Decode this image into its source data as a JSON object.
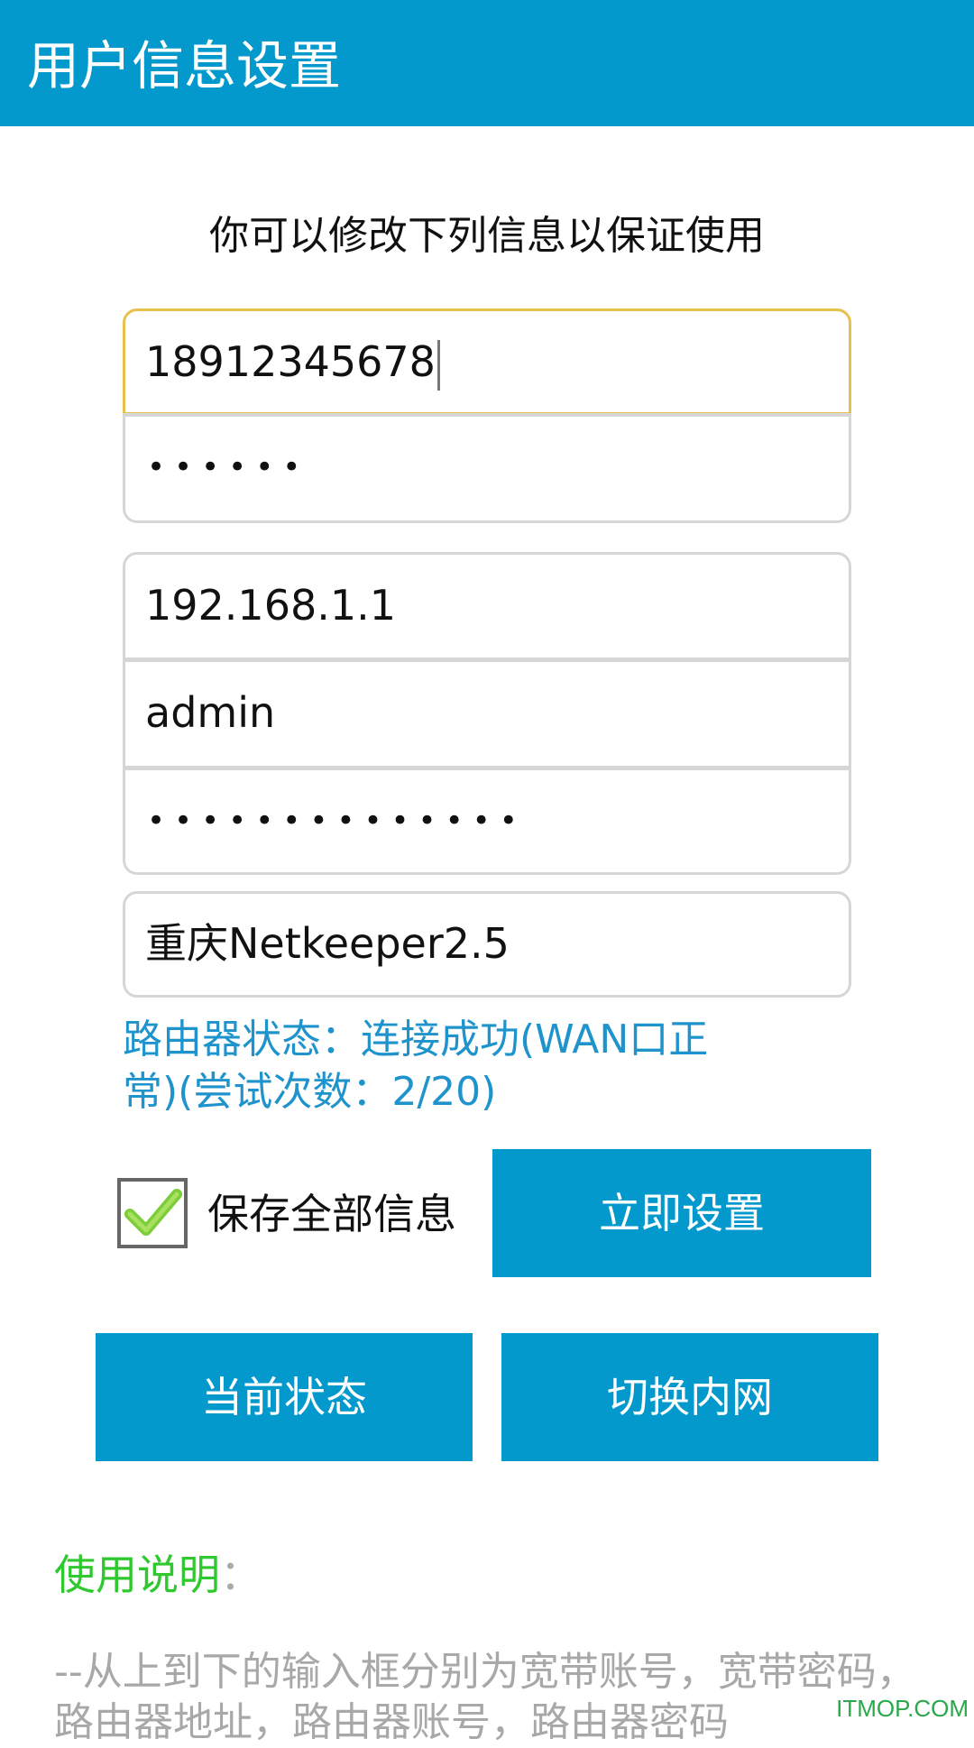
{
  "title_bar": {
    "title": "用户信息设置"
  },
  "subtitle": "你可以修改下列信息以保证使用",
  "fields": {
    "broadband_account": "18912345678",
    "broadband_password_masked": "••••••",
    "router_address": "192.168.1.1",
    "router_account": "admin",
    "router_password_masked": "••••••••••••••",
    "dial_mode": "重庆Netkeeper2.5"
  },
  "router_status": {
    "line1": "路由器状态：连接成功(WAN口正",
    "line2": "常)(尝试次数：2/20)"
  },
  "save_all": {
    "label": "保存全部信息",
    "checked": true
  },
  "buttons": {
    "apply_now": "立即设置",
    "current_status": "当前状态",
    "switch_intranet": "切换内网"
  },
  "help": {
    "title": "使用说明",
    "colon": "：",
    "text": "--从上到下的输入框分别为宽带账号，宽带密码，路由器地址，路由器账号，路由器密码"
  },
  "watermark": "ITMOP.COM",
  "colors": {
    "primary": "#0499cc",
    "status_text": "#1e93cc",
    "help_title": "#2fc92f",
    "focus_border": "#e8c04c"
  }
}
